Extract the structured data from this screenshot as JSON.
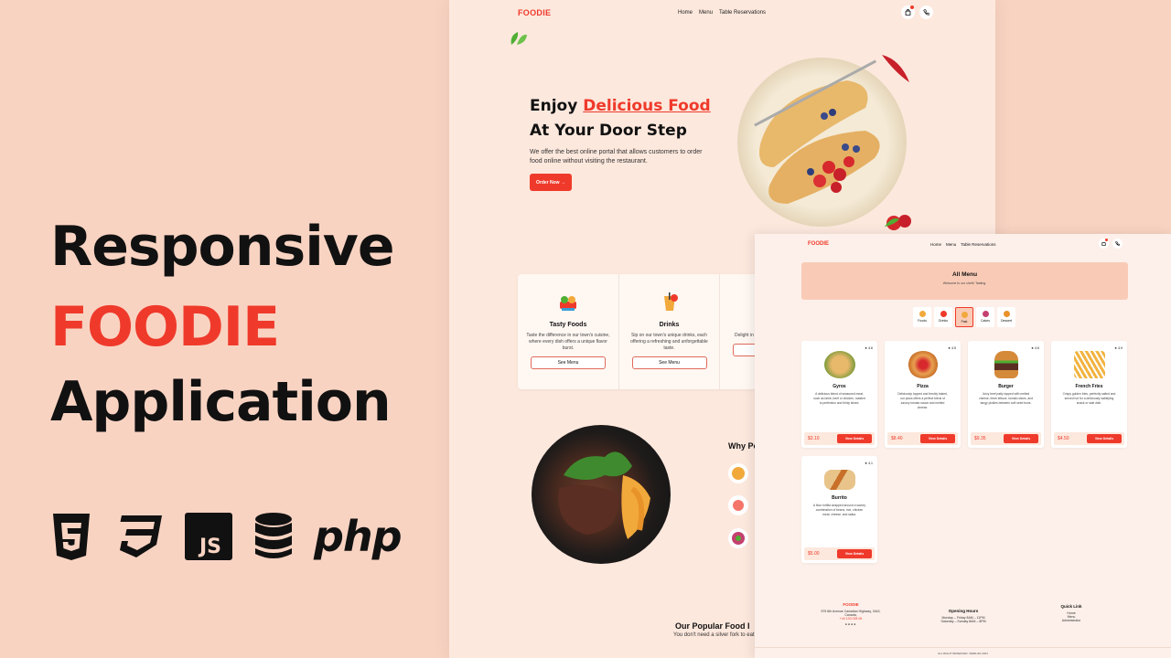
{
  "promo": {
    "line1": "Responsive",
    "line2": "FOODIE",
    "line3": "Application",
    "tech_icons": [
      "html5-icon",
      "css3-icon",
      "js-icon",
      "database-icon"
    ],
    "php": "php"
  },
  "colors": {
    "accent": "#ef3a2b",
    "background": "#f9d3c2",
    "page": "#fde8dd"
  },
  "site": {
    "logo": "FOODIE",
    "nav": [
      "Home",
      "Menu",
      "Table Reservations"
    ],
    "hero": {
      "title_a": "Enjoy ",
      "title_red": "Delicious Food",
      "title_b": "At Your Door Step",
      "desc": "We offer the best online portal that allows customers to order food online without visiting the restaurant.",
      "order_btn": "Order Now →"
    },
    "cards": [
      {
        "title": "Tasty Foods",
        "desc": "Taste the difference in our town's cuisine, where every dish offers a unique flavor burst.",
        "btn": "See Menu"
      },
      {
        "title": "Drinks",
        "desc": "Sip on our town's unique drinks, each offering a refreshing and unforgettable taste.",
        "btn": "See Menu"
      },
      {
        "title": "",
        "desc": "Delight in brimmin",
        "btn": ""
      }
    ],
    "why_title": "Why Pe",
    "popular_title": "Our Popular Food I",
    "popular_sub": "You don't need a silver fork to eat go"
  },
  "menu_page": {
    "logo": "FOODIE",
    "nav": [
      "Home",
      "Menu",
      "Table Reservations"
    ],
    "banner_title": "All Menu",
    "banner_sub": "Welcome to our chefs' Tasting.",
    "categories": [
      "Foods",
      "Drinks",
      "Fast",
      "Cakes",
      "Dessert"
    ],
    "active_category": "Fast",
    "items": [
      {
        "name": "Gyros",
        "rating": "4.6",
        "desc": "A delicious blend of seasoned meat, such as lamb, beef or chicken, roasted to perfection and thinly sliced.",
        "price": "$3.10",
        "btn": "View Details"
      },
      {
        "name": "Pizza",
        "rating": "4.5",
        "desc": "Deliciously topped and freshly baked, our pizza offers a perfect blend of savory tomato sauce and melted cheese.",
        "price": "$8.40",
        "btn": "View Details"
      },
      {
        "name": "Burger",
        "rating": "4.6",
        "desc": "Juicy beef patty topped with melted cheese, fresh lettuce, tomato slices, and tangy pickles between soft seed buns.",
        "price": "$9.35",
        "btn": "View Details"
      },
      {
        "name": "French Fries",
        "rating": "4.9",
        "desc": "Crispy golden fries, perfectly salted and served hot for a deliciously satisfying snack or side dish.",
        "price": "$4.50",
        "btn": "View Details"
      },
      {
        "name": "Burrito",
        "rating": "4.1",
        "desc": "A flour tortilla wrapped around a savory combination of beans, rice, chicken meat, cheese, and salsa.",
        "price": "$5.00",
        "btn": "View Details"
      }
    ],
    "footer": {
      "brand": "FOODIE",
      "address": "575 6th Avenue Canadian Highway, 3442, Canada,",
      "phone": "+44 133 028 06",
      "hours_title": "Opening Hours",
      "hours_1": "Monday – Friday 8AM – 11PM",
      "hours_2": "Saturday – Sunday 8AM – 8PM",
      "links_title": "Quick Link",
      "links": [
        "Home",
        "Menu",
        "Administrator"
      ],
      "copyright": "ALL RIGHT RESERVED. WEBLIZA 2024"
    }
  }
}
